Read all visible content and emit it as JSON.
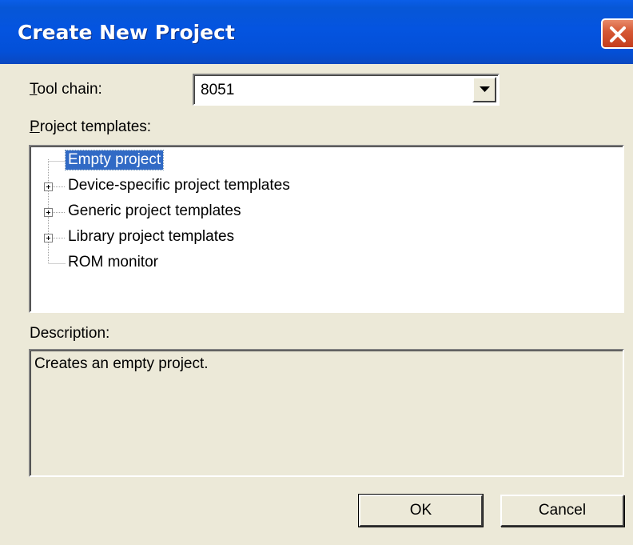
{
  "window": {
    "title": "Create New Project"
  },
  "toolchain": {
    "label_accel": "T",
    "label_rest": "ool chain:",
    "value": "8051"
  },
  "templates": {
    "label_accel": "P",
    "label_rest": "roject templates:",
    "items": [
      {
        "label": "Empty project",
        "selected": true,
        "expandable": false
      },
      {
        "label": "Device-specific project templates",
        "selected": false,
        "expandable": true
      },
      {
        "label": "Generic project templates",
        "selected": false,
        "expandable": true
      },
      {
        "label": "Library project templates",
        "selected": false,
        "expandable": true
      },
      {
        "label": "ROM monitor",
        "selected": false,
        "expandable": false
      }
    ]
  },
  "description": {
    "label": "Description:",
    "text": "Creates an empty project."
  },
  "buttons": {
    "ok": "OK",
    "cancel": "Cancel"
  },
  "icons": {
    "close": "close-icon",
    "dropdown": "dropdown-arrow-icon",
    "expand": "plus-expander-icon"
  },
  "colors": {
    "titlebar": "#0454e0",
    "selection": "#316ac5",
    "close_button": "#d65a36",
    "dialog_bg": "#ece9d8"
  }
}
